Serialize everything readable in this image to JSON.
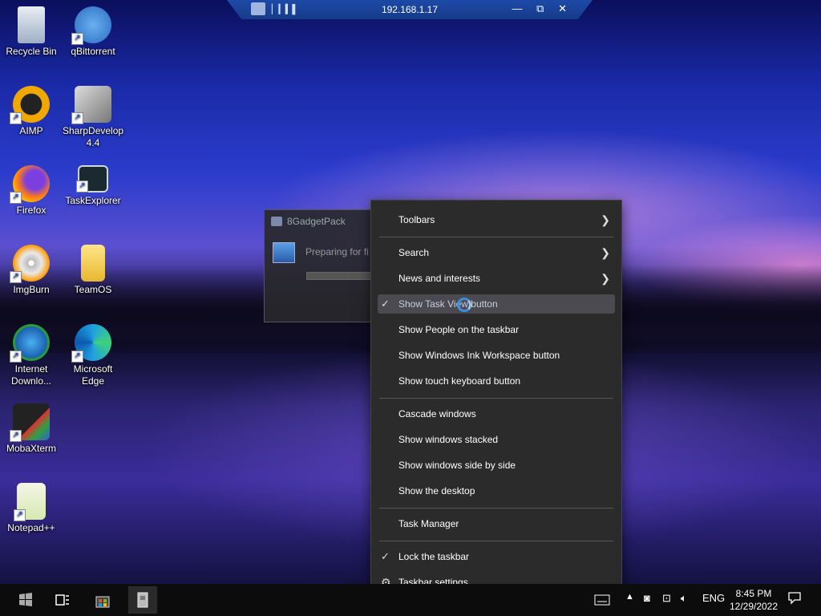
{
  "remote_bar": {
    "title": "192.168.1.17",
    "signal": "▏▎▍▌",
    "minimize": "—",
    "restore": "⧉",
    "close": "✕"
  },
  "desktop_icons": [
    {
      "label": "Recycle Bin",
      "icon": "recycle-bin-icon"
    },
    {
      "label": "qBittorrent",
      "icon": "qbittorrent-icon"
    },
    {
      "label": "AIMP",
      "icon": "aimp-icon"
    },
    {
      "label": "SharpDevelop 4.4",
      "icon": "sharpdevelop-icon"
    },
    {
      "label": "Firefox",
      "icon": "firefox-icon"
    },
    {
      "label": "TaskExplorer",
      "icon": "taskexplorer-icon"
    },
    {
      "label": "ImgBurn",
      "icon": "imgburn-icon"
    },
    {
      "label": "TeamOS",
      "icon": "folder-icon"
    },
    {
      "label": "Internet Downlo...",
      "icon": "internet-download-manager-icon"
    },
    {
      "label": "Microsoft Edge",
      "icon": "edge-icon"
    },
    {
      "label": "MobaXterm",
      "icon": "mobaxterm-icon"
    },
    {
      "label": "Notepad++",
      "icon": "notepadpp-icon"
    }
  ],
  "gadget_dialog": {
    "title": "8GadgetPack",
    "text": "Preparing for fi"
  },
  "context_menu": {
    "toolbars": "Toolbars",
    "search": "Search",
    "news": "News and interests",
    "task_view": "Show Task View button",
    "people": "Show People on the taskbar",
    "ink": "Show Windows Ink Workspace button",
    "touch_kbd": "Show touch keyboard button",
    "cascade": "Cascade windows",
    "stacked": "Show windows stacked",
    "side_by_side": "Show windows side by side",
    "desktop": "Show the desktop",
    "task_manager": "Task Manager",
    "lock": "Lock the taskbar",
    "settings": "Taskbar settings",
    "chevron": "❯",
    "check": "✓",
    "gear": "⚙"
  },
  "taskbar": {
    "language": "ENG",
    "time": "8:45 PM",
    "date": "12/29/2022"
  }
}
